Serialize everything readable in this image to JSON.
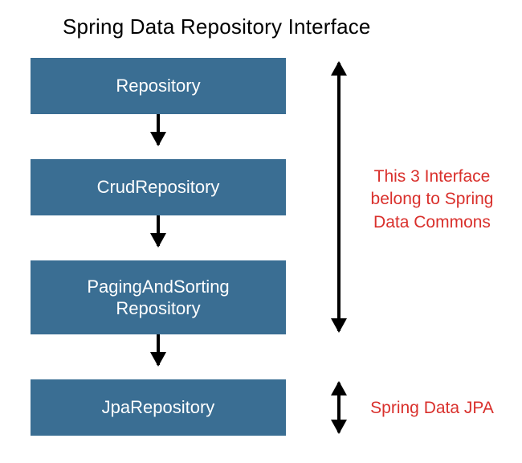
{
  "title": "Spring Data Repository Interface",
  "boxes": {
    "repository": "Repository",
    "crud": "CrudRepository",
    "paging": "PagingAndSorting Repository",
    "jpa": "JpaRepository"
  },
  "annotations": {
    "commons": "This 3 Interface belong to Spring Data Commons",
    "jpa": "Spring Data JPA"
  },
  "colors": {
    "box_bg": "#3a6e93",
    "box_text": "#ffffff",
    "annotation": "#d9302c",
    "arrow": "#000000"
  }
}
